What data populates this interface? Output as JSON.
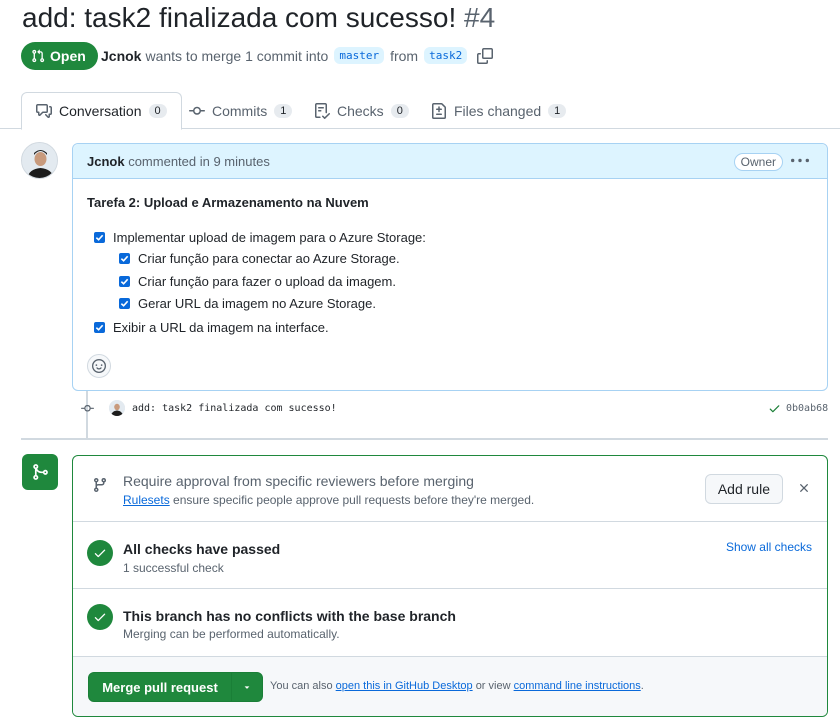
{
  "pr": {
    "title": "add: task2 finalizada com sucesso!",
    "number": "#4",
    "state": "Open",
    "author": "Jcnok",
    "merge_text": "wants to merge 1 commit into",
    "base_branch": "master",
    "from_text": "from",
    "head_branch": "task2"
  },
  "tabs": [
    {
      "label": "Conversation",
      "count": "0",
      "icon": "comment-discussion-icon"
    },
    {
      "label": "Commits",
      "count": "1",
      "icon": "git-commit-icon"
    },
    {
      "label": "Checks",
      "count": "0",
      "icon": "checklist-icon"
    },
    {
      "label": "Files changed",
      "count": "1",
      "icon": "file-diff-icon"
    }
  ],
  "comment": {
    "author": "Jcnok",
    "action": "commented in 9 minutes",
    "badge": "Owner",
    "heading": "Tarefa 2: Upload e Armazenamento na Nuvem",
    "tasks": [
      "Implementar upload de imagem para o Azure Storage:",
      "Criar função para conectar ao Azure Storage.",
      "Criar função para fazer o upload da imagem.",
      "Gerar URL da imagem no Azure Storage.",
      "Exibir a URL da imagem na interface."
    ]
  },
  "commit": {
    "message": "add: task2 finalizada com sucesso!",
    "sha": "0b0ab68"
  },
  "merge": {
    "ruleset_title": "Require approval from specific reviewers before merging",
    "ruleset_link": "Rulesets",
    "ruleset_desc": "ensure specific people approve pull requests before they're merged.",
    "add_rule": "Add rule",
    "checks_title": "All checks have passed",
    "checks_sub": "1 successful check",
    "show_all": "Show all checks",
    "conflict_title": "This branch has no conflicts with the base branch",
    "conflict_sub": "Merging can be performed automatically.",
    "merge_button": "Merge pull request",
    "also_prefix": "You can also",
    "desktop_link": "open this in GitHub Desktop",
    "or_view": "or view",
    "cli_link": "command line instructions",
    "period": "."
  },
  "colors": {
    "green": "#1f883d",
    "blue": "#0969da",
    "comment_header": "#ddf4ff"
  }
}
